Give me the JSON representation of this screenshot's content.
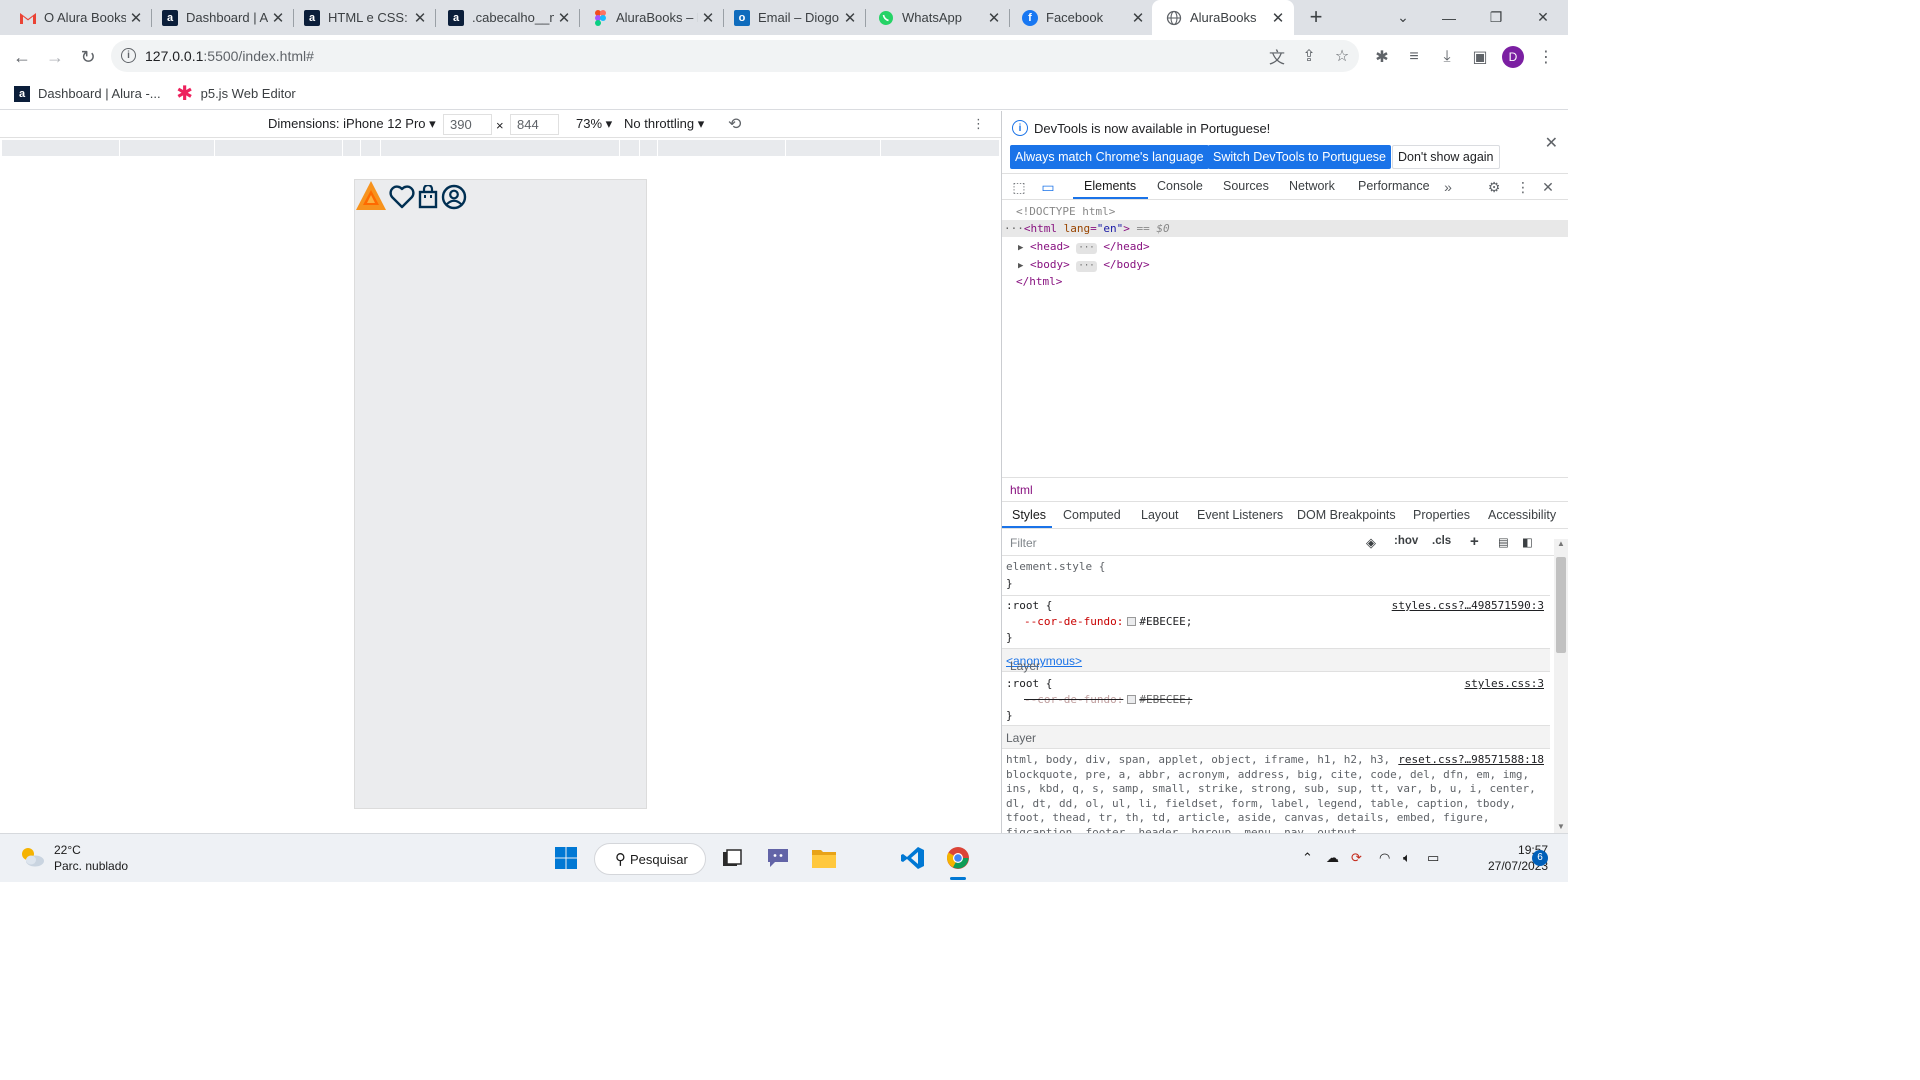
{
  "browser": {
    "tabs": [
      {
        "title": "O Alura Books",
        "favicon": "gmail-icon"
      },
      {
        "title": "Dashboard | A",
        "favicon": "alura-icon"
      },
      {
        "title": "HTML e CSS: r",
        "favicon": "alura-icon"
      },
      {
        "title": ".cabecalho__m",
        "favicon": "alura-icon"
      },
      {
        "title": "AluraBooks – F",
        "favicon": "figma-icon"
      },
      {
        "title": "Email – Diogo",
        "favicon": "outlook-icon"
      },
      {
        "title": "WhatsApp",
        "favicon": "whatsapp-icon"
      },
      {
        "title": "Facebook",
        "favicon": "facebook-icon"
      },
      {
        "title": "AluraBooks",
        "favicon": "globe-icon",
        "active": true
      }
    ],
    "url_host": "127.0.0.1",
    "url_rest": ":5500/index.html#",
    "profile_initial": "D",
    "bookmarks": [
      {
        "label": "Dashboard | Alura -...",
        "icon": "alura-icon"
      },
      {
        "label": "p5.js Web Editor",
        "icon": "p5js-icon"
      }
    ]
  },
  "device_toolbar": {
    "dimensions": "Dimensions: iPhone 12 Pro",
    "width": "390",
    "times": "×",
    "height": "844",
    "zoom": "73%",
    "throttling": "No throttling"
  },
  "devtools": {
    "info_message": "DevTools is now available in Portuguese!",
    "btn_match": "Always match Chrome's language",
    "btn_switch": "Switch DevTools to Portuguese",
    "btn_dont_show": "Don't show again",
    "tabs": [
      "Elements",
      "Console",
      "Sources",
      "Network",
      "Performance"
    ],
    "dom": {
      "doctype": "<!DOCTYPE html>",
      "html_open_tag": "<html",
      "html_attr": "lang",
      "html_attr_val": "\"en\"",
      "html_close_bracket": ">",
      "selected_marker": "== $0",
      "head_open": "<head>",
      "head_close": "</head>",
      "body_open": "<body>",
      "body_close": "</body>",
      "html_close": "</html>"
    },
    "breadcrumb": "html",
    "style_tabs": [
      "Styles",
      "Computed",
      "Layout",
      "Event Listeners",
      "DOM Breakpoints",
      "Properties",
      "Accessibility"
    ],
    "filter_placeholder": "Filter",
    "filter_hov": ":hov",
    "filter_cls": ".cls",
    "rules": {
      "element_style": "element.style {",
      "close_brace": "}",
      "root_selector": ":root {",
      "root_prop": "--cor-de-fundo:",
      "root_value": "#EBECEE;",
      "root_source": "styles.css?…498571590:3",
      "layer_label": "Layer",
      "layer_anon": "<anonymous>",
      "root2_source": "styles.css:3",
      "reset_source": "reset.css?…98571588:18",
      "reset_selectors": "html, body, div, span, applet, object, iframe, h1, h2, h3, h4, h5, h6, p, blockquote, pre, a, abbr, acronym, address, big, cite, code, del, dfn, em, img, ins, kbd, q, s, samp, small, strike, strong, sub, sup, tt, var, b, u, i, center, dl, dt, dd, ol, ul, li, fieldset, form, label, legend, table, caption, tbody, tfoot, thead, tr, th, td, article, aside, canvas, details, embed, figure, figcaption, footer, header, hgroup, menu, nav, output"
    }
  },
  "taskbar": {
    "temp": "22°C",
    "weather": "Parc. nublado",
    "search": "Pesquisar",
    "time": "19:57",
    "date": "27/07/2023",
    "notifications": "6"
  },
  "colors": {
    "accent": "#1a73e8",
    "device_bg": "#EBECEE",
    "logo_orange": "#f7931e"
  }
}
